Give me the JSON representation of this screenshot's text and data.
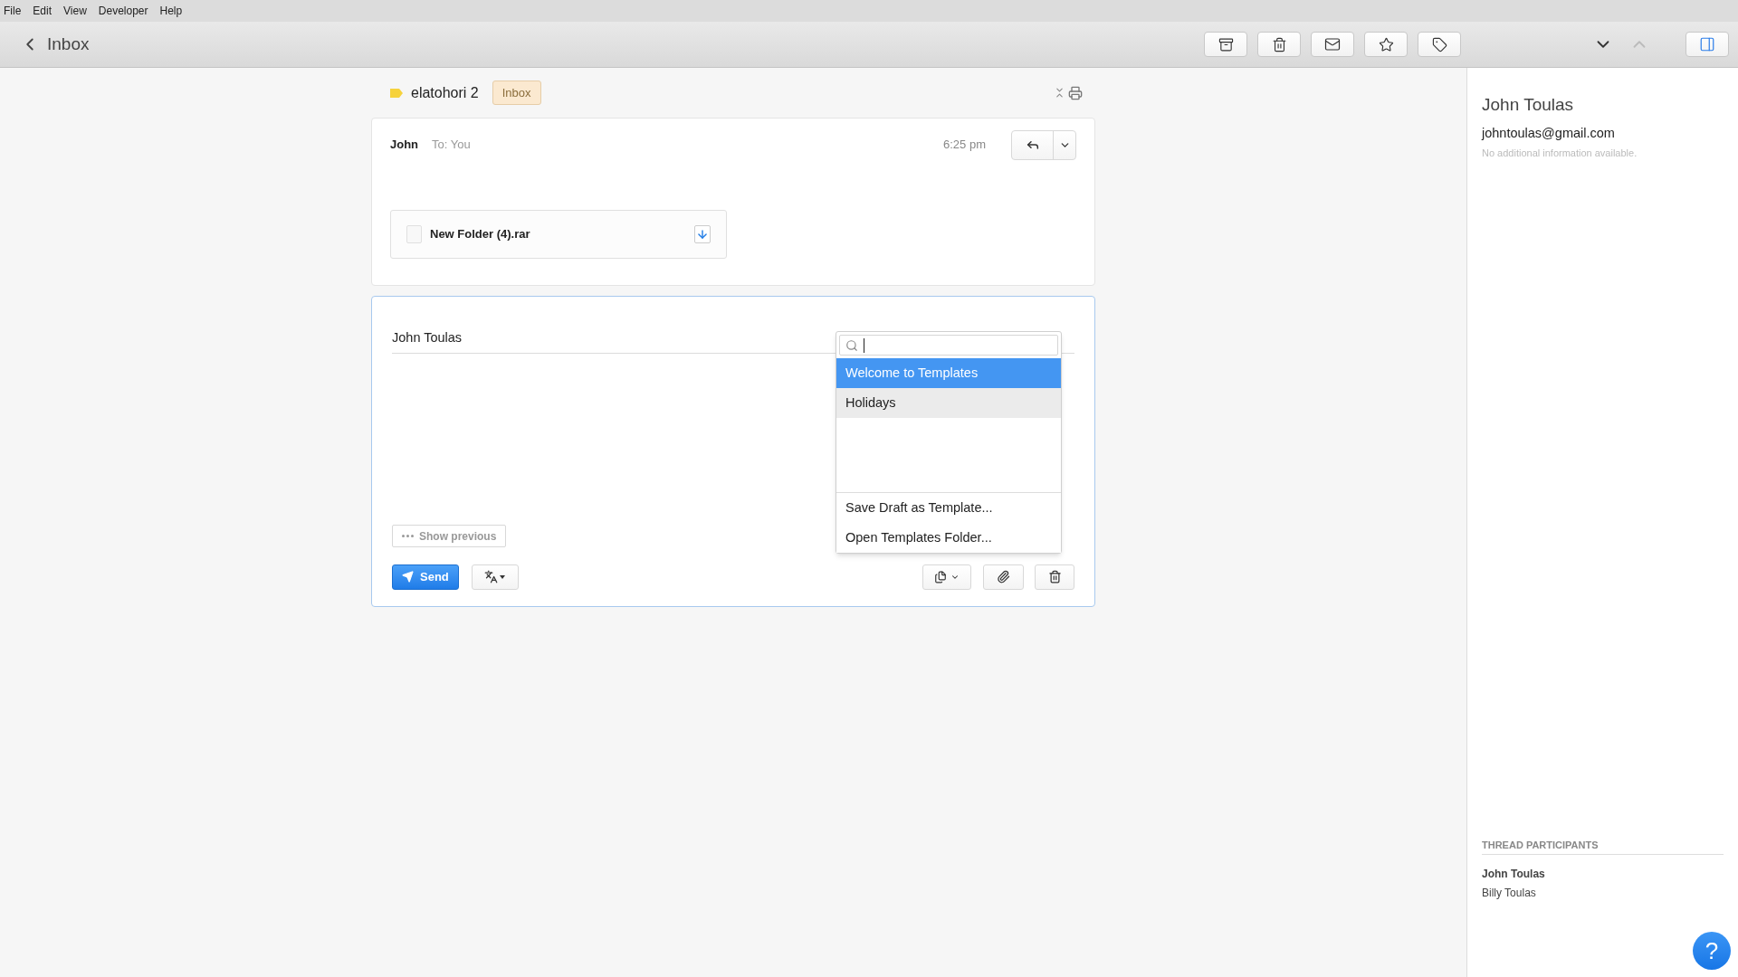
{
  "menu_bar": [
    "File",
    "Edit",
    "View",
    "Developer",
    "Help"
  ],
  "toolbar": {
    "back_label": "Inbox",
    "next_disabled": false,
    "previous_disabled": true,
    "sidebar_on": true
  },
  "thread": {
    "subject": "elatohori 2",
    "label": "Inbox",
    "message": {
      "from": "John",
      "to": "To: You",
      "time": "6:25 pm",
      "attachment": {
        "name": "New Folder (4).rar"
      }
    },
    "draft": {
      "recipient": "John Toulas",
      "show_previous": "Show previous",
      "send": "Send",
      "templates_menu": {
        "items": [
          {
            "kind": "template",
            "label": "Welcome to Templates",
            "selected": true,
            "hovered": false
          },
          {
            "kind": "template",
            "label": "Holidays",
            "selected": false,
            "hovered": true
          },
          {
            "kind": "action",
            "label": "Save Draft as Template...",
            "selected": false,
            "hovered": false
          },
          {
            "kind": "action",
            "label": "Open Templates Folder...",
            "selected": false,
            "hovered": false
          }
        ]
      }
    }
  },
  "sidebar": {
    "name": "John Toulas",
    "email": "johntoulas@gmail.com",
    "info": "No additional information available.",
    "participants_title": "THREAD PARTICIPANTS",
    "participants": [
      {
        "name": "John Toulas",
        "emphasized": true
      },
      {
        "name": "Billy Toulas",
        "emphasized": false
      }
    ],
    "help": "?"
  }
}
